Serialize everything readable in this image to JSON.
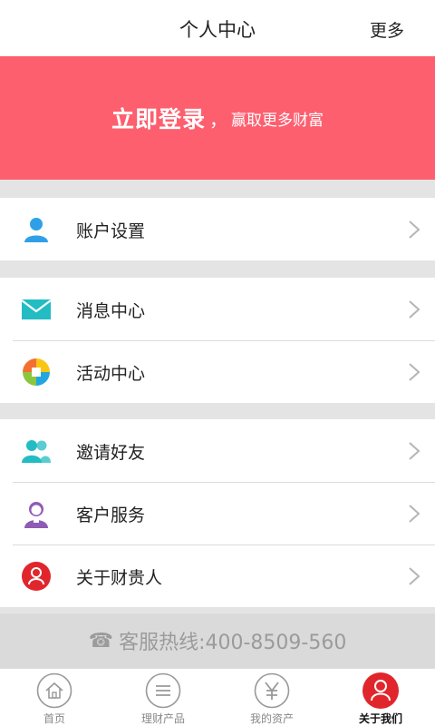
{
  "header": {
    "title": "个人中心",
    "more_label": "更多"
  },
  "banner": {
    "login_label": "立即登录",
    "separator": "，",
    "tagline": "赢取更多财富",
    "color": "#fd5f6f"
  },
  "menu": {
    "group1": [
      {
        "label": "账户设置",
        "icon": "user-icon"
      }
    ],
    "group2": [
      {
        "label": "消息中心",
        "icon": "envelope-icon"
      },
      {
        "label": "活动中心",
        "icon": "activity-icon"
      }
    ],
    "group3": [
      {
        "label": "邀请好友",
        "icon": "friends-icon"
      },
      {
        "label": "客户服务",
        "icon": "customer-service-icon"
      },
      {
        "label": "关于财贵人",
        "icon": "about-icon"
      }
    ]
  },
  "hotline": {
    "icon": "phone-icon",
    "text": "客服热线:400-8509-560"
  },
  "tabbar": {
    "tabs": [
      {
        "label": "首页",
        "icon": "home-icon"
      },
      {
        "label": "理财产品",
        "icon": "list-icon"
      },
      {
        "label": "我的资产",
        "icon": "yen-icon"
      },
      {
        "label": "关于我们",
        "icon": "person-icon",
        "active": true
      }
    ]
  },
  "colors": {
    "accent": "#e0262c",
    "brand": "#fd5f6f"
  }
}
